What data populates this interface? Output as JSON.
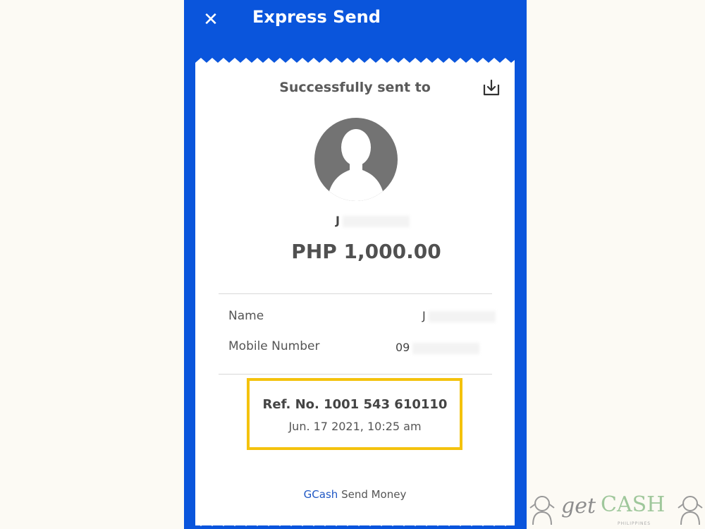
{
  "header": {
    "title": "Express Send"
  },
  "receipt": {
    "heading": "Successfully sent to",
    "recipient_initial": "J",
    "amount": "PHP 1,000.00",
    "details": {
      "name_label": "Name",
      "name_value": "J",
      "mobile_label": "Mobile Number",
      "mobile_value": "09"
    },
    "reference": "Ref. No. 1001 543 610110",
    "datetime": "Jun. 17 2021, 10:25 am",
    "footer_brand": "GCash",
    "footer_text": "Send Money"
  },
  "watermark": {
    "get": "get",
    "cash": "CASH",
    "sub": "PHILIPPINES"
  },
  "colors": {
    "brand_blue": "#0a55dc",
    "highlight": "#f4c20d"
  }
}
